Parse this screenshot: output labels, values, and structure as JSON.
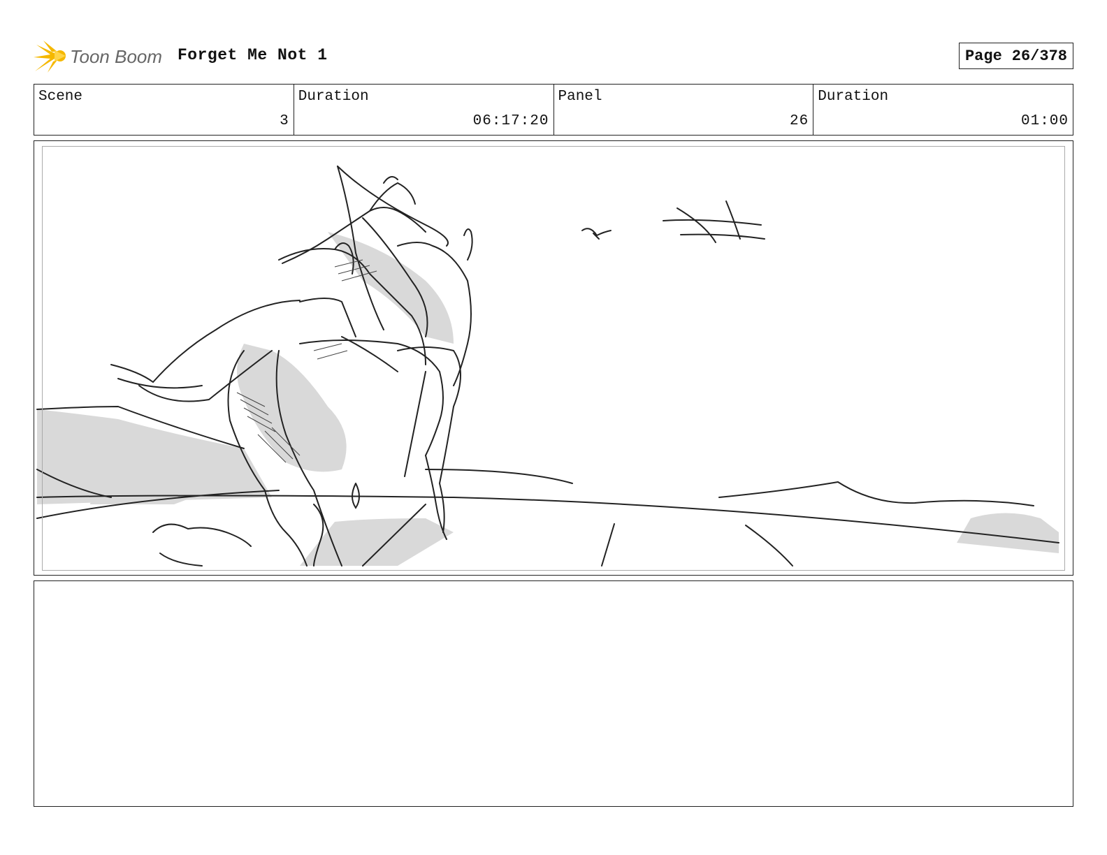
{
  "header": {
    "logo_text": "Toon Boom",
    "project_title": "Forget Me Not 1",
    "page_label": "Page",
    "page_value": "26/378"
  },
  "info": {
    "scene_label": "Scene",
    "scene_value": "3",
    "scene_duration_label": "Duration",
    "scene_duration_value": "06:17:20",
    "panel_label": "Panel",
    "panel_value": "26",
    "panel_duration_label": "Duration",
    "panel_duration_value": "01:00"
  },
  "colors": {
    "logo_yellow": "#f5b800",
    "logo_text": "#666666",
    "sketch_line": "#222222",
    "sketch_shade": "#d9d9d9"
  },
  "icons": {
    "logo": "toon-boom-starburst-icon"
  }
}
